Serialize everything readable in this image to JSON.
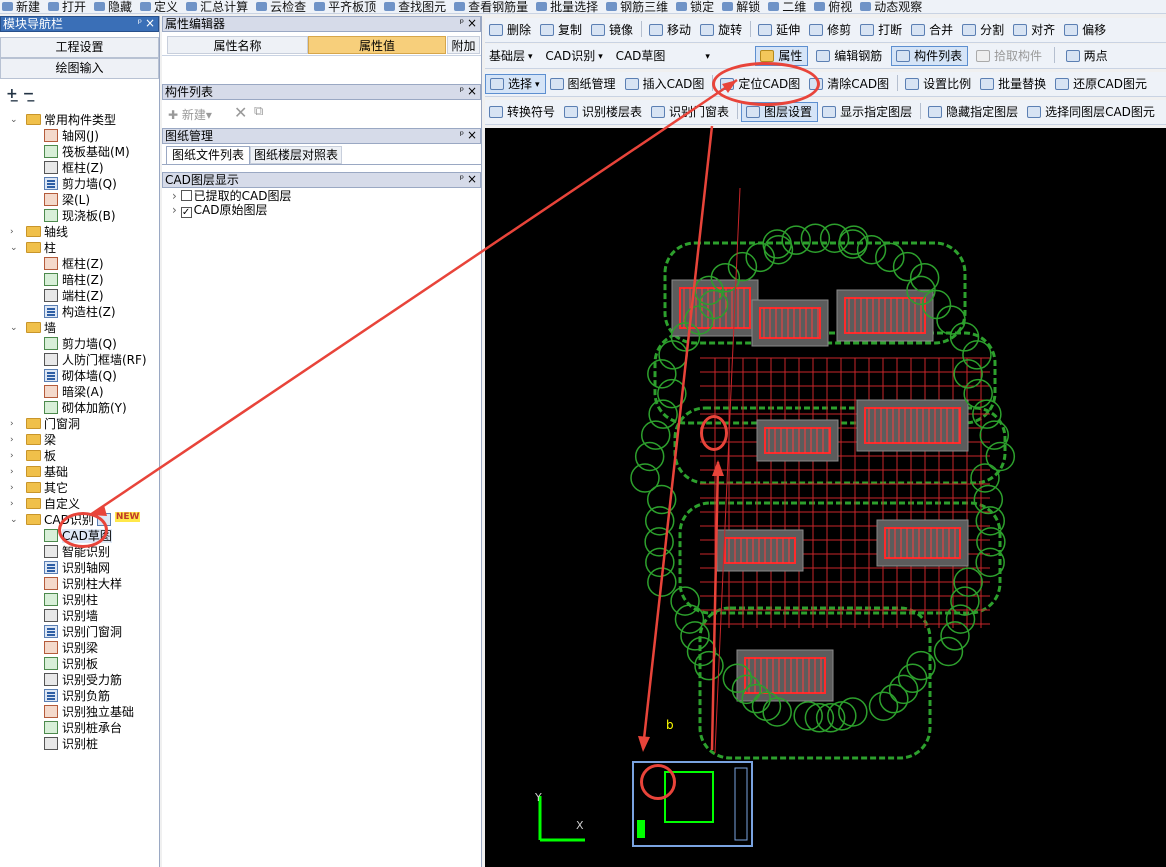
{
  "topbar": [
    "新建",
    "打开",
    "隐藏",
    "定义",
    "汇总计算",
    "云检查",
    "平齐板顶",
    "查找图元",
    "查看钢筋量",
    "批量选择",
    "钢筋三维",
    "锁定",
    "解锁",
    "二维",
    "俯视",
    "动态观察"
  ],
  "nav": {
    "title": "模块导航栏",
    "pin": "ᵖ",
    "close": "×",
    "btn_project": "工程设置",
    "btn_drawing": "绘图输入",
    "tree": [
      {
        "level": 0,
        "type": "folder",
        "open": true,
        "label": "常用构件类型"
      },
      {
        "level": 1,
        "type": "icon",
        "label": "轴网(J)"
      },
      {
        "level": 1,
        "type": "icon",
        "label": "筏板基础(M)"
      },
      {
        "level": 1,
        "type": "icon",
        "label": "框柱(Z)"
      },
      {
        "level": 1,
        "type": "icon",
        "label": "剪力墙(Q)"
      },
      {
        "level": 1,
        "type": "icon",
        "label": "梁(L)"
      },
      {
        "level": 1,
        "type": "icon",
        "label": "现浇板(B)"
      },
      {
        "level": 0,
        "type": "folder",
        "open": false,
        "label": "轴线"
      },
      {
        "level": 0,
        "type": "folder",
        "open": true,
        "label": "柱"
      },
      {
        "level": 1,
        "type": "icon",
        "label": "框柱(Z)"
      },
      {
        "level": 1,
        "type": "icon",
        "label": "暗柱(Z)"
      },
      {
        "level": 1,
        "type": "icon",
        "label": "端柱(Z)"
      },
      {
        "level": 1,
        "type": "icon",
        "label": "构造柱(Z)"
      },
      {
        "level": 0,
        "type": "folder",
        "open": true,
        "label": "墙"
      },
      {
        "level": 1,
        "type": "icon",
        "label": "剪力墙(Q)"
      },
      {
        "level": 1,
        "type": "icon",
        "label": "人防门框墙(RF)"
      },
      {
        "level": 1,
        "type": "icon",
        "label": "砌体墙(Q)"
      },
      {
        "level": 1,
        "type": "icon",
        "label": "暗梁(A)"
      },
      {
        "level": 1,
        "type": "icon",
        "label": "砌体加筋(Y)"
      },
      {
        "level": 0,
        "type": "folder",
        "open": false,
        "label": "门窗洞"
      },
      {
        "level": 0,
        "type": "folder",
        "open": false,
        "label": "梁"
      },
      {
        "level": 0,
        "type": "folder",
        "open": false,
        "label": "板"
      },
      {
        "level": 0,
        "type": "folder",
        "open": false,
        "label": "基础"
      },
      {
        "level": 0,
        "type": "folder",
        "open": false,
        "label": "其它"
      },
      {
        "level": 0,
        "type": "folder",
        "open": false,
        "label": "自定义"
      },
      {
        "level": 0,
        "type": "folder",
        "open": true,
        "label": "CAD识别",
        "badge": "NEW"
      },
      {
        "level": 1,
        "type": "icon",
        "label": "CAD草图",
        "selected": true
      },
      {
        "level": 1,
        "type": "icon",
        "label": "智能识别"
      },
      {
        "level": 1,
        "type": "icon",
        "label": "识别轴网"
      },
      {
        "level": 1,
        "type": "icon",
        "label": "识别柱大样"
      },
      {
        "level": 1,
        "type": "icon",
        "label": "识别柱"
      },
      {
        "level": 1,
        "type": "icon",
        "label": "识别墙"
      },
      {
        "level": 1,
        "type": "icon",
        "label": "识别门窗洞"
      },
      {
        "level": 1,
        "type": "icon",
        "label": "识别梁"
      },
      {
        "level": 1,
        "type": "icon",
        "label": "识别板"
      },
      {
        "level": 1,
        "type": "icon",
        "label": "识别受力筋"
      },
      {
        "level": 1,
        "type": "icon",
        "label": "识别负筋"
      },
      {
        "level": 1,
        "type": "icon",
        "label": "识别独立基础"
      },
      {
        "level": 1,
        "type": "icon",
        "label": "识别桩承台"
      },
      {
        "level": 1,
        "type": "icon",
        "label": "识别桩"
      }
    ]
  },
  "prop_editor": {
    "title": "属性编辑器",
    "col_name": "属性名称",
    "col_value": "属性值",
    "col_add": "附加"
  },
  "comp_list": {
    "title": "构件列表",
    "new": "新建"
  },
  "drawing_mgr": {
    "title": "图纸管理",
    "tab1": "图纸文件列表",
    "tab2": "图纸楼层对照表"
  },
  "cad_layers": {
    "title": "CAD图层显示",
    "items": [
      {
        "label": "已提取的CAD图层",
        "checked": false
      },
      {
        "label": "CAD原始图层",
        "checked": true
      }
    ]
  },
  "ribbon": {
    "row1": [
      "删除",
      "复制",
      "镜像",
      "移动",
      "旋转",
      "延伸",
      "修剪",
      "打断",
      "合并",
      "分割",
      "对齐",
      "偏移"
    ],
    "row2": {
      "floor": "基础层",
      "mode": "CAD识别",
      "sub": "CAD草图",
      "btn_prop": "属性",
      "btn_edit": "编辑钢筋",
      "btn_list": "构件列表",
      "btn_pick": "拾取构件",
      "btn_two": "两点"
    },
    "row3": [
      "选择",
      "图纸管理",
      "插入CAD图",
      "定位CAD图",
      "清除CAD图",
      "设置比例",
      "批量替换",
      "还原CAD图元"
    ],
    "row4": [
      "转换符号",
      "识别楼层表",
      "识别门窗表",
      "图层设置",
      "显示指定图层",
      "隐藏指定图层",
      "选择同图层CAD图元"
    ]
  },
  "cad": {
    "axis_y": "Y",
    "axis_x": "X",
    "marker": "b"
  },
  "colors": {
    "accent": "#3a6fb7",
    "annotation": "#e8443a",
    "cad_bg": "#000000",
    "cad_grid": "#c8262a",
    "cad_green": "#2da02d"
  }
}
